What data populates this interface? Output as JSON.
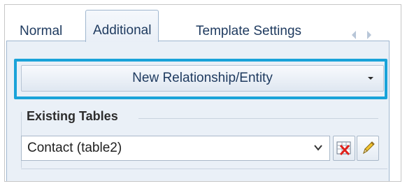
{
  "tabs": [
    {
      "label": "Normal",
      "active": false
    },
    {
      "label": "Additional",
      "active": true
    },
    {
      "label": "Template Settings",
      "active": false
    }
  ],
  "new_relationship": {
    "label": "New Relationship/Entity"
  },
  "existing_tables": {
    "group_label": "Existing Tables",
    "selected_value": "Contact  (table2)"
  },
  "icons": {
    "tab_scroll_left": "chevron-left-icon",
    "tab_scroll_right": "chevron-right-icon",
    "dropdown": "chevron-down-icon",
    "delete": "delete-table-icon",
    "edit": "pencil-icon"
  },
  "colors": {
    "highlight": "#1aa3d9",
    "panel_background": "#eaf0f7",
    "tab_text": "#1e3a5f"
  }
}
